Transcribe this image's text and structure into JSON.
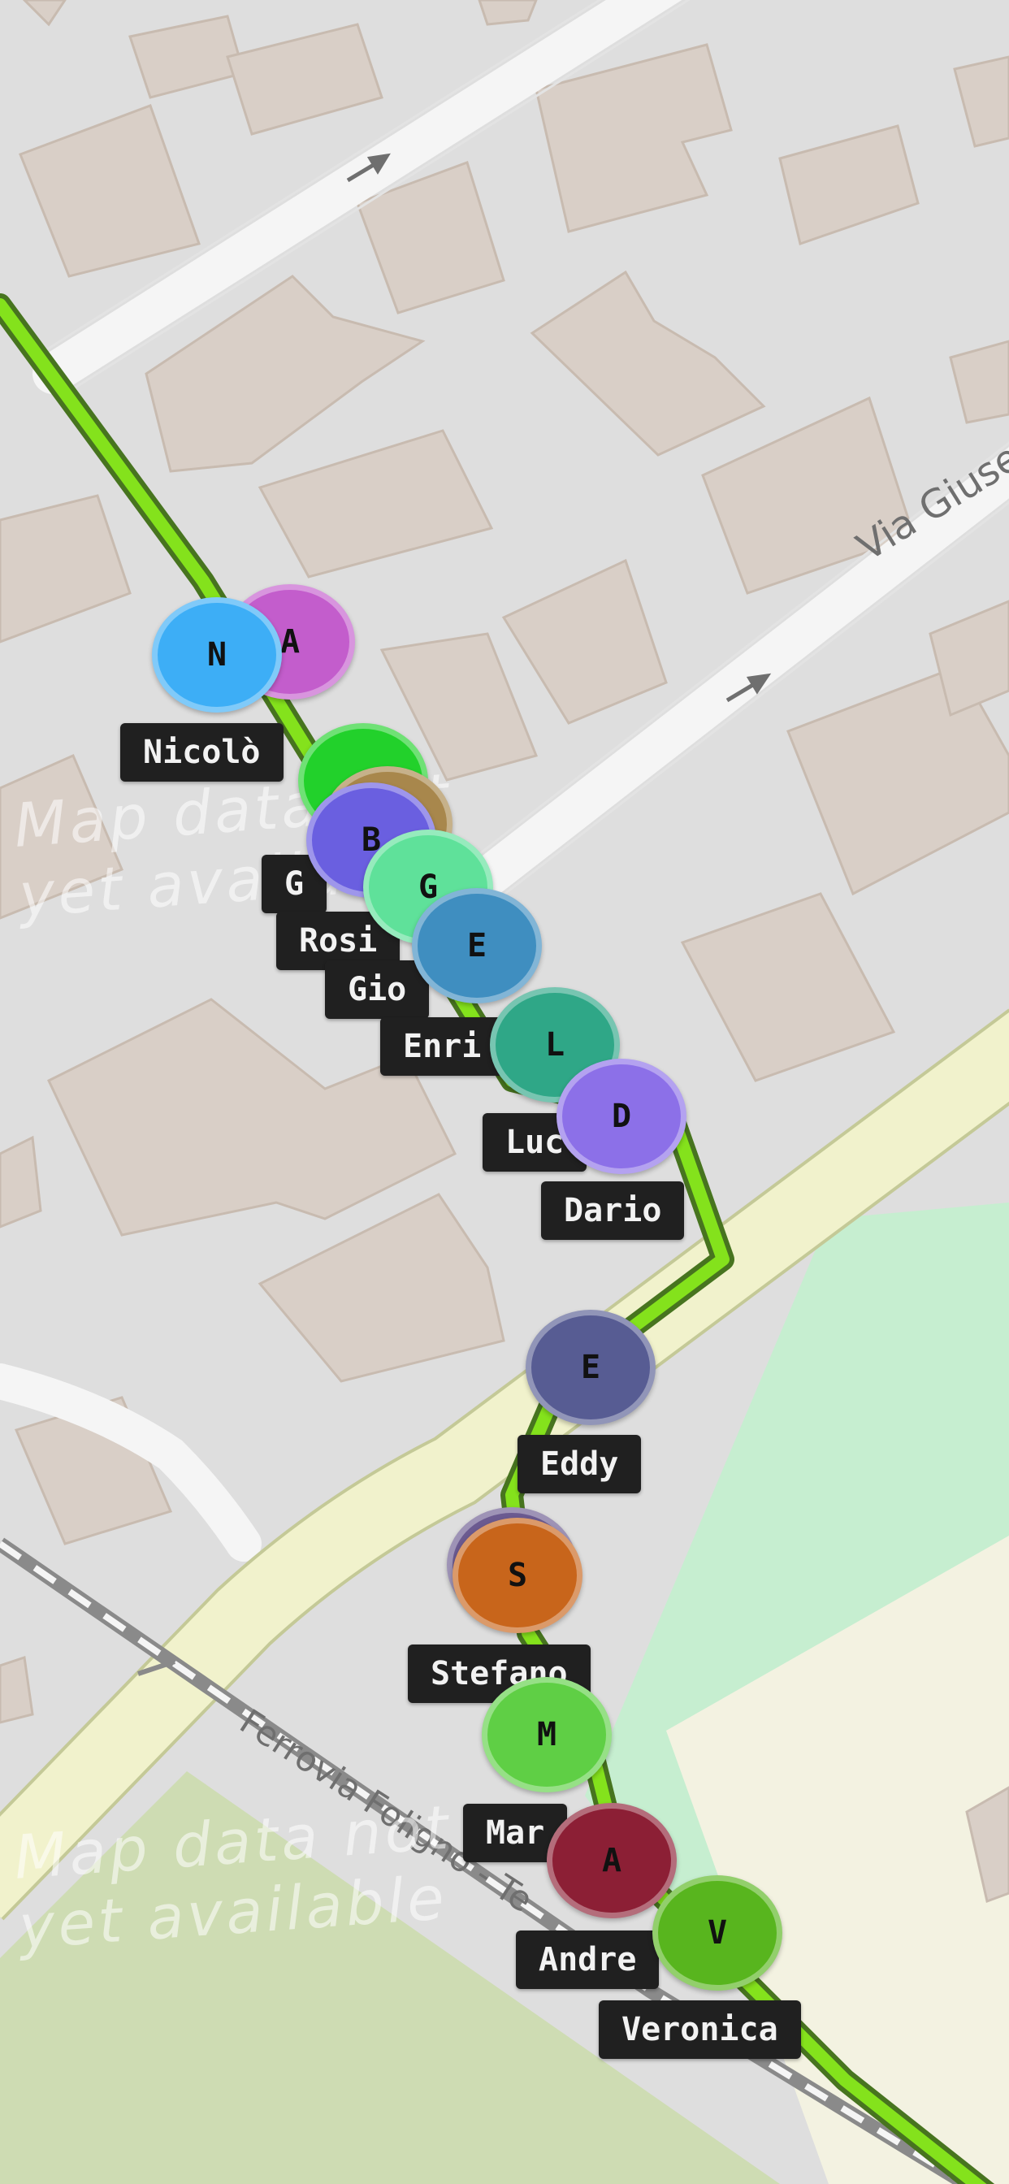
{
  "map": {
    "street_labels": {
      "via_giuseppe": "Via Giuse",
      "railway": "Ferrovia Foligno - Te"
    },
    "no_data_text": "Map data not\nyet available"
  },
  "markers": [
    {
      "letter": "A",
      "name": "",
      "color": "#c35dcc"
    },
    {
      "letter": "N",
      "name": "Nicolò",
      "color": "#3daef6"
    },
    {
      "letter": "",
      "name": "",
      "color": "#22d12b"
    },
    {
      "letter": "",
      "name": "",
      "color": "#a8874c"
    },
    {
      "letter": "B",
      "name": "G",
      "color": "#6a5fe0"
    },
    {
      "letter": "",
      "name": "Rosi",
      "color": ""
    },
    {
      "letter": "G",
      "name": "Gio",
      "color": "#5fe19a"
    },
    {
      "letter": "E",
      "name": "Enri",
      "color": "#3f8ec0"
    },
    {
      "letter": "L",
      "name": "Luc",
      "color": "#2fa787"
    },
    {
      "letter": "D",
      "name": "Dario",
      "color": "#8c70e8"
    },
    {
      "letter": "E",
      "name": "Eddy",
      "color": "#575c93"
    },
    {
      "letter": "",
      "name": "",
      "color": "#6b5a90"
    },
    {
      "letter": "S",
      "name": "Stefano",
      "color": "#c8651b"
    },
    {
      "letter": "M",
      "name": "Mar",
      "color": "#5fcf45"
    },
    {
      "letter": "A",
      "name": "Andre",
      "color": "#8c1f35"
    },
    {
      "letter": "V",
      "name": "Veronica",
      "color": "#58b51e"
    }
  ]
}
